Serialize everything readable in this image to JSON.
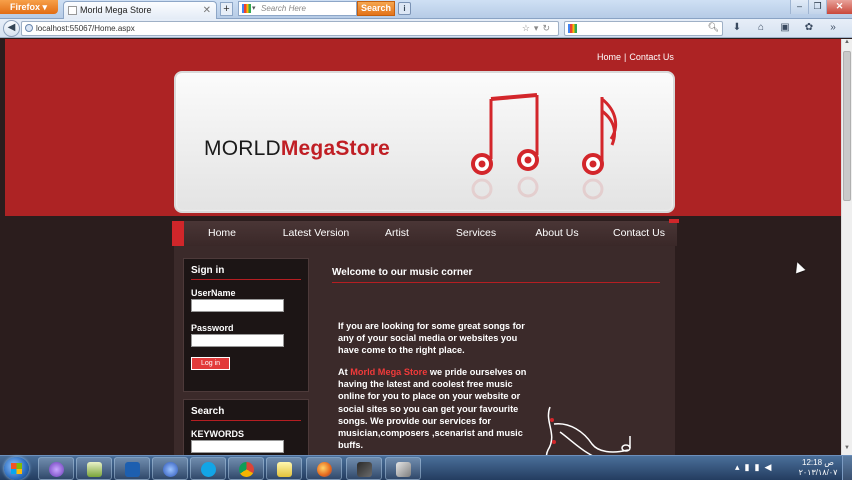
{
  "browser": {
    "menu_button": "Firefox",
    "tab_title": "Morld Mega Store",
    "search_placeholder": "Search Here",
    "search_button": "Search",
    "url": "localhost:55067/Home.aspx",
    "colors": {
      "firefox_orange": "#e3731a",
      "chrome_blue": "#c2d4ea"
    }
  },
  "site": {
    "top_links": [
      "Home",
      "Contact Us"
    ],
    "logo_part1": "MORLD",
    "logo_part2": "MegaStore",
    "menu": [
      "Home",
      "Latest Version",
      "Artist",
      "Services",
      "About Us",
      "Contact Us"
    ],
    "signin": {
      "title": "Sign in",
      "username_label": "UserName",
      "password_label": "Password",
      "login_button": "Log in"
    },
    "search": {
      "title": "Search",
      "keywords_label": "KEYWORDS"
    },
    "welcome_title": "Welcome to our music corner",
    "para1": "If you are looking for some great songs for any of your social media or websites you have come to the right place.",
    "para2_prefix": "At ",
    "para2_brand": "Morld Mega Store",
    "para2_rest": " we pride ourselves on having the latest and coolest free music online for you to place on your website or social sites so you can get your favourite songs. We provide our services for musician,composers ,scenarist and music buffs.",
    "colors": {
      "brand_red": "#ad2324",
      "dark_bg": "#2b1d1d",
      "accent_red": "#c01e24"
    }
  },
  "taskbar": {
    "clock_ampm": "ص",
    "clock_time": "12:18",
    "clock_date": "٢٠١٣/١٨/٠٧"
  }
}
